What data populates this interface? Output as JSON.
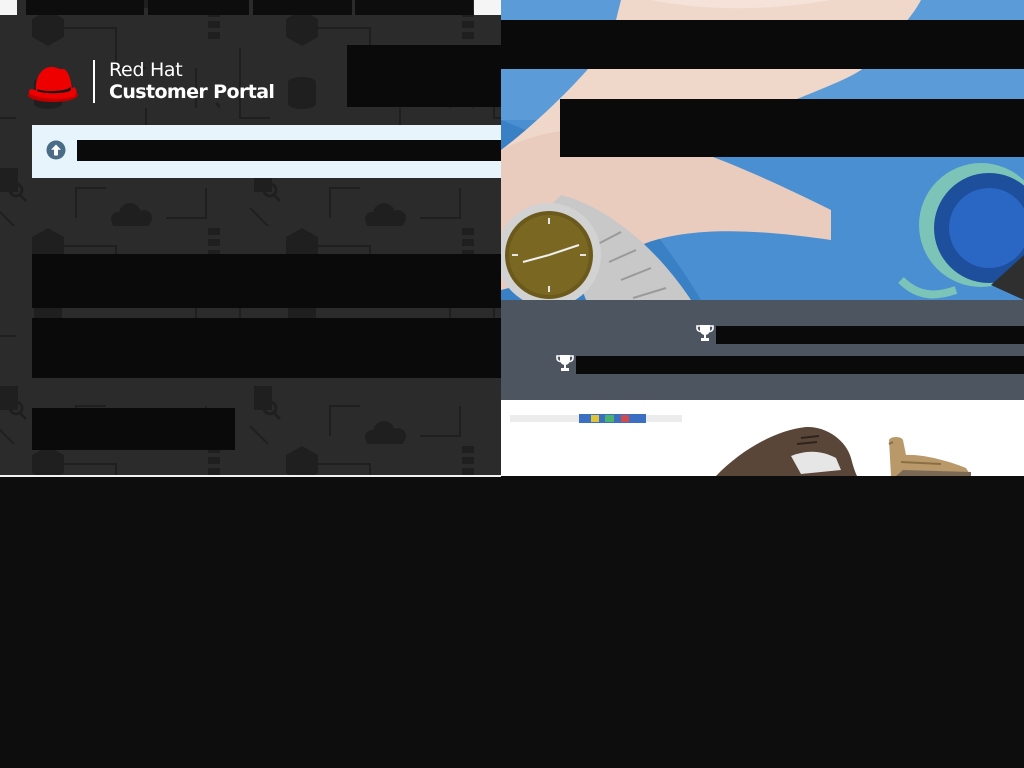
{
  "brand": {
    "name_line1": "Red Hat",
    "name_line2": "Customer Portal",
    "logo_icon": "red-hat-fedora-icon",
    "accent_color": "#ee0000"
  },
  "notice": {
    "icon": "arrow-up-circle-icon",
    "background_color": "#e8f4fb"
  },
  "stats": {
    "icon": "trophy-icon",
    "background_color": "#4d5660"
  }
}
